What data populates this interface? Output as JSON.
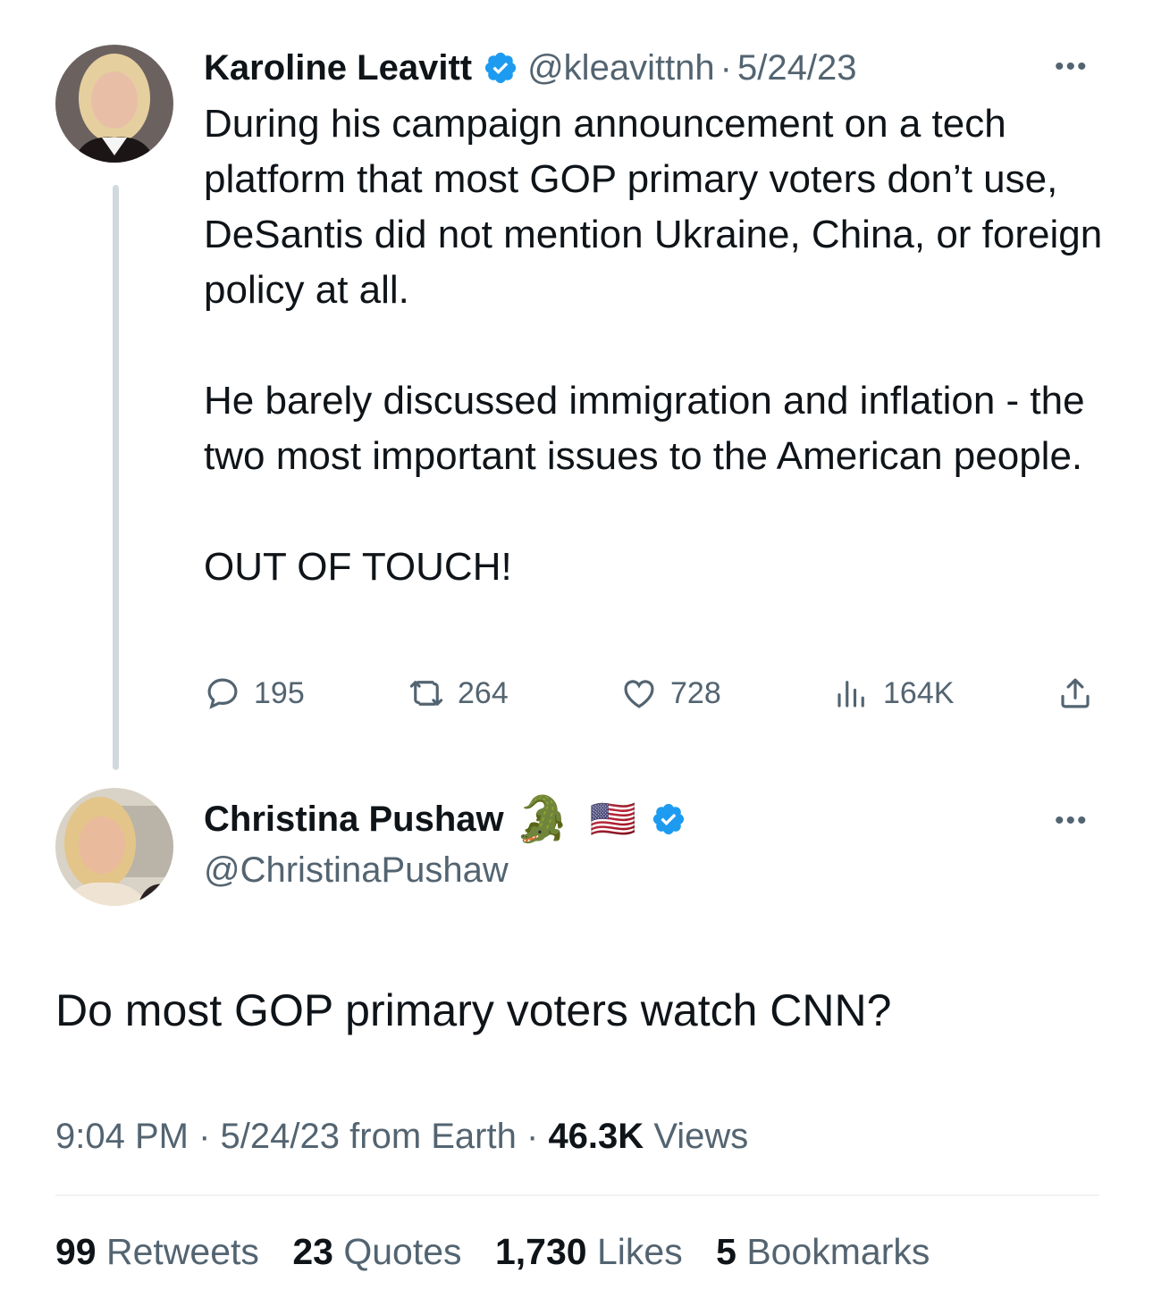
{
  "quoted_tweet": {
    "author_name": "Karoline Leavitt",
    "handle": "@kleavittnh",
    "separator": "·",
    "date": "5/24/23",
    "more": "•••",
    "text": "During his campaign announcement on a tech platform that most GOP primary voters don’t use, DeSantis did not mention Ukraine, China, or foreign policy at all.\n\nHe barely discussed immigration and inflation - the two most important issues to the American people.\n\nOUT OF TOUCH!",
    "replies": "195",
    "retweets": "264",
    "likes": "728",
    "views": "164K"
  },
  "main_tweet": {
    "author_name": "Christina Pushaw",
    "name_emoji": "🐊",
    "flag_emoji": "🇺🇸",
    "handle": "@ChristinaPushaw",
    "more": "•••",
    "text": "Do most GOP primary voters watch CNN?",
    "time": "9:04 PM",
    "separator": "·",
    "date": "5/24/23",
    "source": "from Earth",
    "views_count": "46.3K",
    "views_label": "Views"
  },
  "engagement": {
    "retweets_count": "99",
    "retweets_label": "Retweets",
    "quotes_count": "23",
    "quotes_label": "Quotes",
    "likes_count": "1,730",
    "likes_label": "Likes",
    "bookmarks_count": "5",
    "bookmarks_label": "Bookmarks"
  },
  "colors": {
    "verified_blue": "#1d9bf0",
    "text_primary": "#0f1419",
    "text_secondary": "#536471",
    "thread_line": "#cfd9de"
  },
  "icons": [
    "reply-icon",
    "retweet-icon",
    "like-icon",
    "views-icon",
    "share-icon",
    "verified-badge-icon",
    "more-icon"
  ]
}
